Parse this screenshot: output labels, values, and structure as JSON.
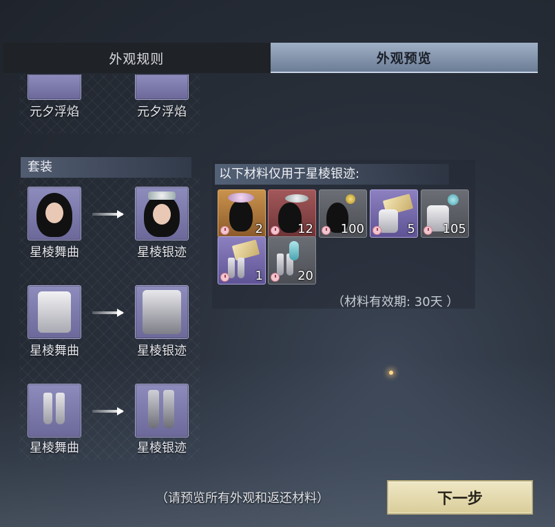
{
  "tabs": {
    "rules": "外观规则",
    "preview": "外观预览"
  },
  "top_items": [
    {
      "label": "元夕浮焰"
    },
    {
      "label": "元夕浮焰"
    }
  ],
  "set_section": {
    "title": "套装"
  },
  "conversions": [
    {
      "from": "星棱舞曲",
      "to": "星棱银迹",
      "from_icon": "character-portrait-icon",
      "to_icon": "character-crowned-portrait-icon"
    },
    {
      "from": "星棱舞曲",
      "to": "星棱银迹",
      "from_icon": "robe-icon",
      "to_icon": "armor-robe-icon"
    },
    {
      "from": "星棱舞曲",
      "to": "星棱银迹",
      "from_icon": "boots-icon",
      "to_icon": "greaves-icon"
    }
  ],
  "materials": {
    "header": "以下材料仅用于星棱银迹:",
    "items": [
      {
        "icon": "headpiece-icon",
        "count": "2",
        "rarity": "orange"
      },
      {
        "icon": "hairpin-icon",
        "count": "12",
        "rarity": "red"
      },
      {
        "icon": "hair-ornament-icon",
        "count": "100",
        "rarity": "grey"
      },
      {
        "icon": "scroll-robe-icon",
        "count": "5",
        "rarity": "purple"
      },
      {
        "icon": "robe-fragment-icon",
        "count": "105",
        "rarity": "grey"
      },
      {
        "icon": "scroll-boots-icon",
        "count": "1",
        "rarity": "purple"
      },
      {
        "icon": "boot-fragment-icon",
        "count": "20",
        "rarity": "grey"
      }
    ],
    "validity": "（材料有效期: 30天 ）"
  },
  "footer": {
    "hint": "（请预览所有外观和返还材料）",
    "next_button": "下一步"
  }
}
